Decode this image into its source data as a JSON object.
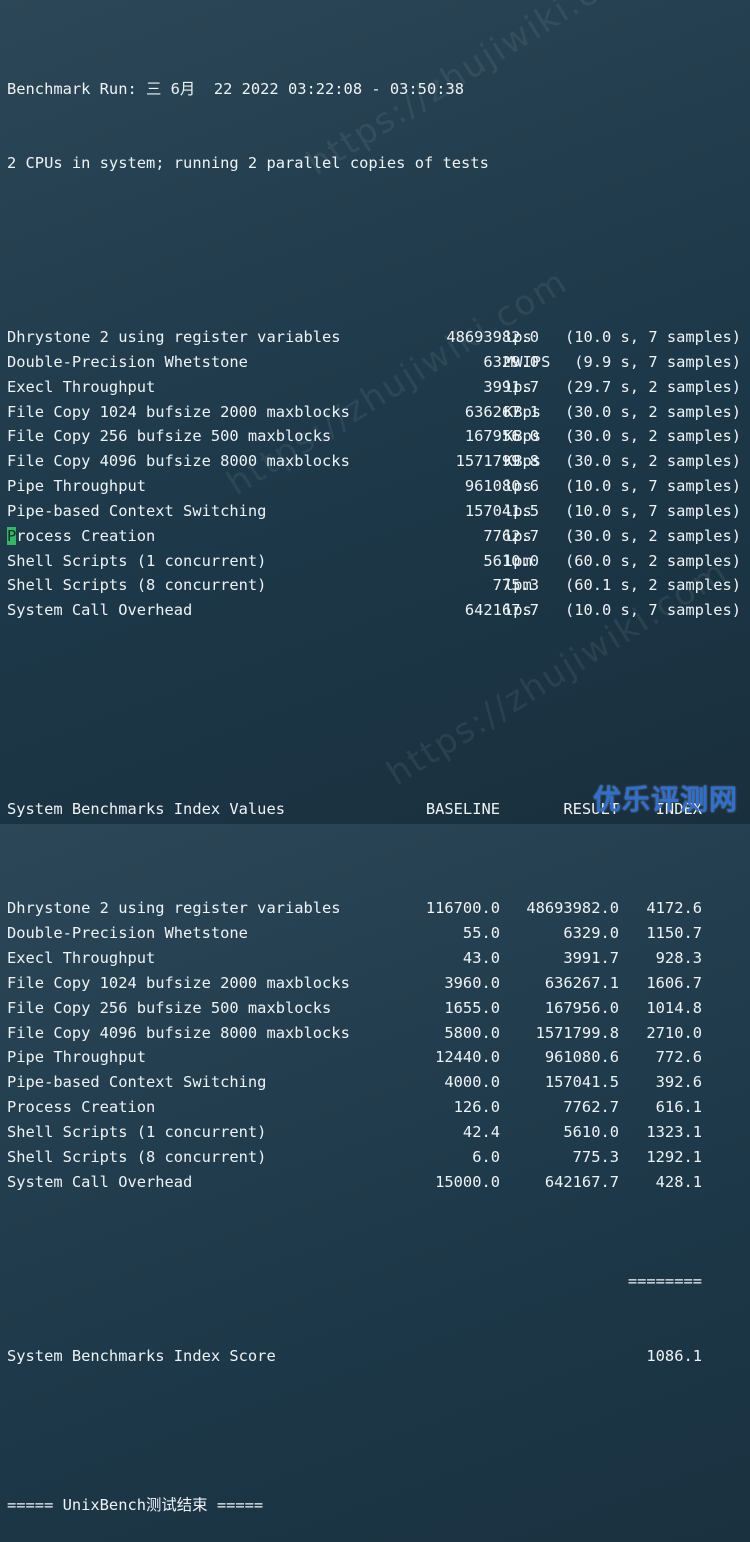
{
  "header": {
    "run_line": "Benchmark Run: 三 6月  22 2022 03:22:08 - 03:50:38",
    "cpu_line": "2 CPUs in system; running 2 parallel copies of tests"
  },
  "results": [
    {
      "name": "Dhrystone 2 using register variables",
      "value": "48693982.0",
      "unit": "lps",
      "detail": "(10.0 s, 7 samples)"
    },
    {
      "name": "Double-Precision Whetstone",
      "value": "6329.0",
      "unit": "MWIPS",
      "detail": "(9.9 s, 7 samples)"
    },
    {
      "name": "Execl Throughput",
      "value": "3991.7",
      "unit": "lps",
      "detail": "(29.7 s, 2 samples)"
    },
    {
      "name": "File Copy 1024 bufsize 2000 maxblocks",
      "value": "636267.1",
      "unit": "KBps",
      "detail": "(30.0 s, 2 samples)"
    },
    {
      "name": "File Copy 256 bufsize 500 maxblocks",
      "value": "167956.0",
      "unit": "KBps",
      "detail": "(30.0 s, 2 samples)"
    },
    {
      "name": "File Copy 4096 bufsize 8000 maxblocks",
      "value": "1571799.8",
      "unit": "KBps",
      "detail": "(30.0 s, 2 samples)"
    },
    {
      "name": "Pipe Throughput",
      "value": "961080.6",
      "unit": "lps",
      "detail": "(10.0 s, 7 samples)"
    },
    {
      "name": "Pipe-based Context Switching",
      "value": "157041.5",
      "unit": "lps",
      "detail": "(10.0 s, 7 samples)"
    },
    {
      "name": "Process Creation",
      "value": "7762.7",
      "unit": "lps",
      "detail": "(30.0 s, 2 samples)"
    },
    {
      "name": "Shell Scripts (1 concurrent)",
      "value": "5610.0",
      "unit": "lpm",
      "detail": "(60.0 s, 2 samples)"
    },
    {
      "name": "Shell Scripts (8 concurrent)",
      "value": "775.3",
      "unit": "lpm",
      "detail": "(60.1 s, 2 samples)"
    },
    {
      "name": "System Call Overhead",
      "value": "642167.7",
      "unit": "lps",
      "detail": "(10.0 s, 7 samples)"
    }
  ],
  "index_table": {
    "title": "System Benchmarks Index Values",
    "headers": {
      "baseline": "BASELINE",
      "result": "RESULT",
      "index": "INDEX"
    },
    "rows": [
      {
        "name": "Dhrystone 2 using register variables",
        "baseline": "116700.0",
        "result": "48693982.0",
        "index": "4172.6"
      },
      {
        "name": "Double-Precision Whetstone",
        "baseline": "55.0",
        "result": "6329.0",
        "index": "1150.7"
      },
      {
        "name": "Execl Throughput",
        "baseline": "43.0",
        "result": "3991.7",
        "index": "928.3"
      },
      {
        "name": "File Copy 1024 bufsize 2000 maxblocks",
        "baseline": "3960.0",
        "result": "636267.1",
        "index": "1606.7"
      },
      {
        "name": "File Copy 256 bufsize 500 maxblocks",
        "baseline": "1655.0",
        "result": "167956.0",
        "index": "1014.8"
      },
      {
        "name": "File Copy 4096 bufsize 8000 maxblocks",
        "baseline": "5800.0",
        "result": "1571799.8",
        "index": "2710.0"
      },
      {
        "name": "Pipe Throughput",
        "baseline": "12440.0",
        "result": "961080.6",
        "index": "772.6"
      },
      {
        "name": "Pipe-based Context Switching",
        "baseline": "4000.0",
        "result": "157041.5",
        "index": "392.6"
      },
      {
        "name": "Process Creation",
        "baseline": "126.0",
        "result": "7762.7",
        "index": "616.1"
      },
      {
        "name": "Shell Scripts (1 concurrent)",
        "baseline": "42.4",
        "result": "5610.0",
        "index": "1323.1"
      },
      {
        "name": "Shell Scripts (8 concurrent)",
        "baseline": "6.0",
        "result": "775.3",
        "index": "1292.1"
      },
      {
        "name": "System Call Overhead",
        "baseline": "15000.0",
        "result": "642167.7",
        "index": "428.1"
      }
    ],
    "separator": "========",
    "score_label": "System Benchmarks Index Score",
    "score_value": "1086.1"
  },
  "footer": {
    "end_line": "===== UnixBench测试结束 ====="
  },
  "watermark": {
    "text": "https://zhujiwiki.com",
    "color": "#ffffff"
  },
  "brand": {
    "logo_text": "优乐评测网",
    "color": "#2f6fd1"
  },
  "cursor": {
    "color": "#2fb86a"
  }
}
